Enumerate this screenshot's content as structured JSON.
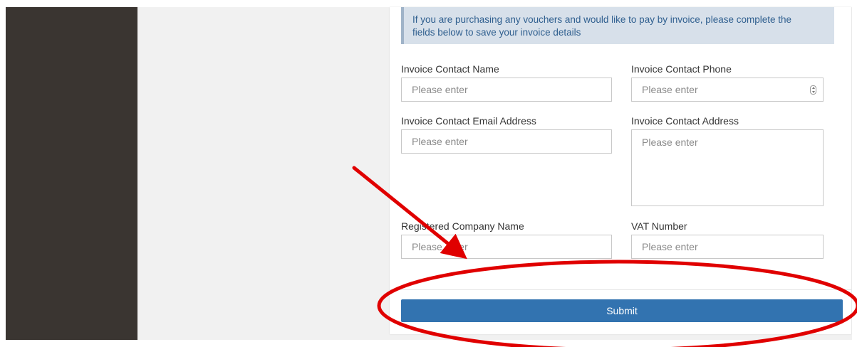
{
  "info": {
    "line1": "If you are purchasing any vouchers and would like to pay by invoice, please complete the",
    "line2": "fields below to save your invoice details"
  },
  "fields": {
    "contact_name": {
      "label": "Invoice Contact Name",
      "placeholder": "Please enter"
    },
    "contact_phone": {
      "label": "Invoice Contact Phone",
      "placeholder": "Please enter"
    },
    "contact_email": {
      "label": "Invoice Contact Email Address",
      "placeholder": "Please enter"
    },
    "contact_address": {
      "label": "Invoice Contact Address",
      "placeholder": "Please enter"
    },
    "company_name": {
      "label": "Registered Company Name",
      "placeholder": "Please enter"
    },
    "vat_number": {
      "label": "VAT Number",
      "placeholder": "Please enter"
    }
  },
  "submit": {
    "label": "Submit"
  },
  "colors": {
    "accent": "#3273b0",
    "annotation": "#e00000",
    "info_background": "#d7e0ea",
    "sidebar": "#3a3531"
  },
  "icons": {
    "phone_stepper": "number-spinner-icon"
  }
}
